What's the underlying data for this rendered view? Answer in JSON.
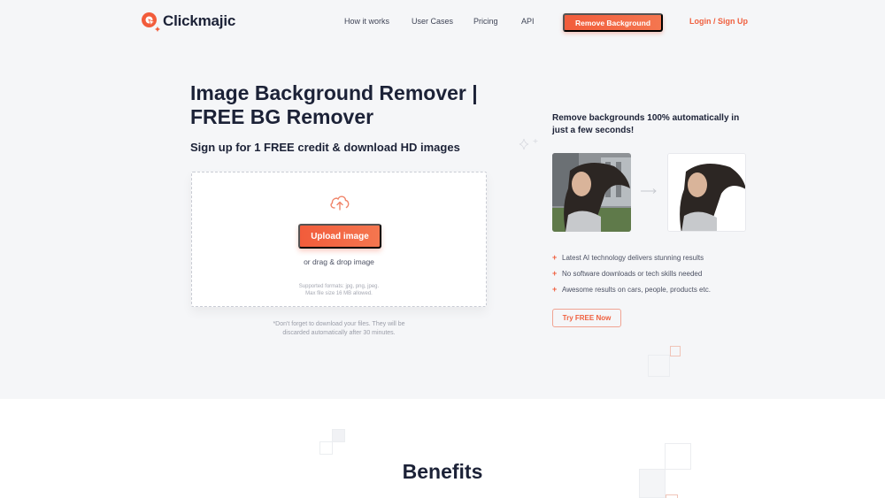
{
  "brand": {
    "name": "Clickmajic",
    "accent": "#f25c3b",
    "text_dark": "#1c2237"
  },
  "nav": {
    "links": [
      "How it works",
      "User Cases",
      "Pricing",
      "API"
    ],
    "cta_label": "Remove Background",
    "login_label": "Login / Sign Up"
  },
  "hero": {
    "title_line1": "Image Background Remover |",
    "title_line2": "FREE BG Remover",
    "subtitle": "Sign up for 1 FREE credit & download HD images"
  },
  "upload": {
    "icon": "cloud-upload-icon",
    "button_label": "Upload image",
    "drag_text": "or drag & drop image",
    "formats_line1": "Supported formats: jpg, png, jpeg.",
    "formats_line2": "Max file size 16 MB allowed.",
    "note_line1": "*Don't forget to download your files. They will be",
    "note_line2": "discarded automatically after 30 minutes."
  },
  "showcase": {
    "title": "Remove backgrounds 100% automatically in just a few seconds!",
    "before_alt": "Original photo of woman with flowing hair",
    "after_alt": "Photo with background removed",
    "features": [
      "Latest AI technology delivers stunning results",
      "No software downloads or tech skills needed",
      "Awesome results on cars, people, products etc."
    ],
    "try_label": "Try FREE Now"
  },
  "benefits": {
    "heading": "Benefits"
  }
}
